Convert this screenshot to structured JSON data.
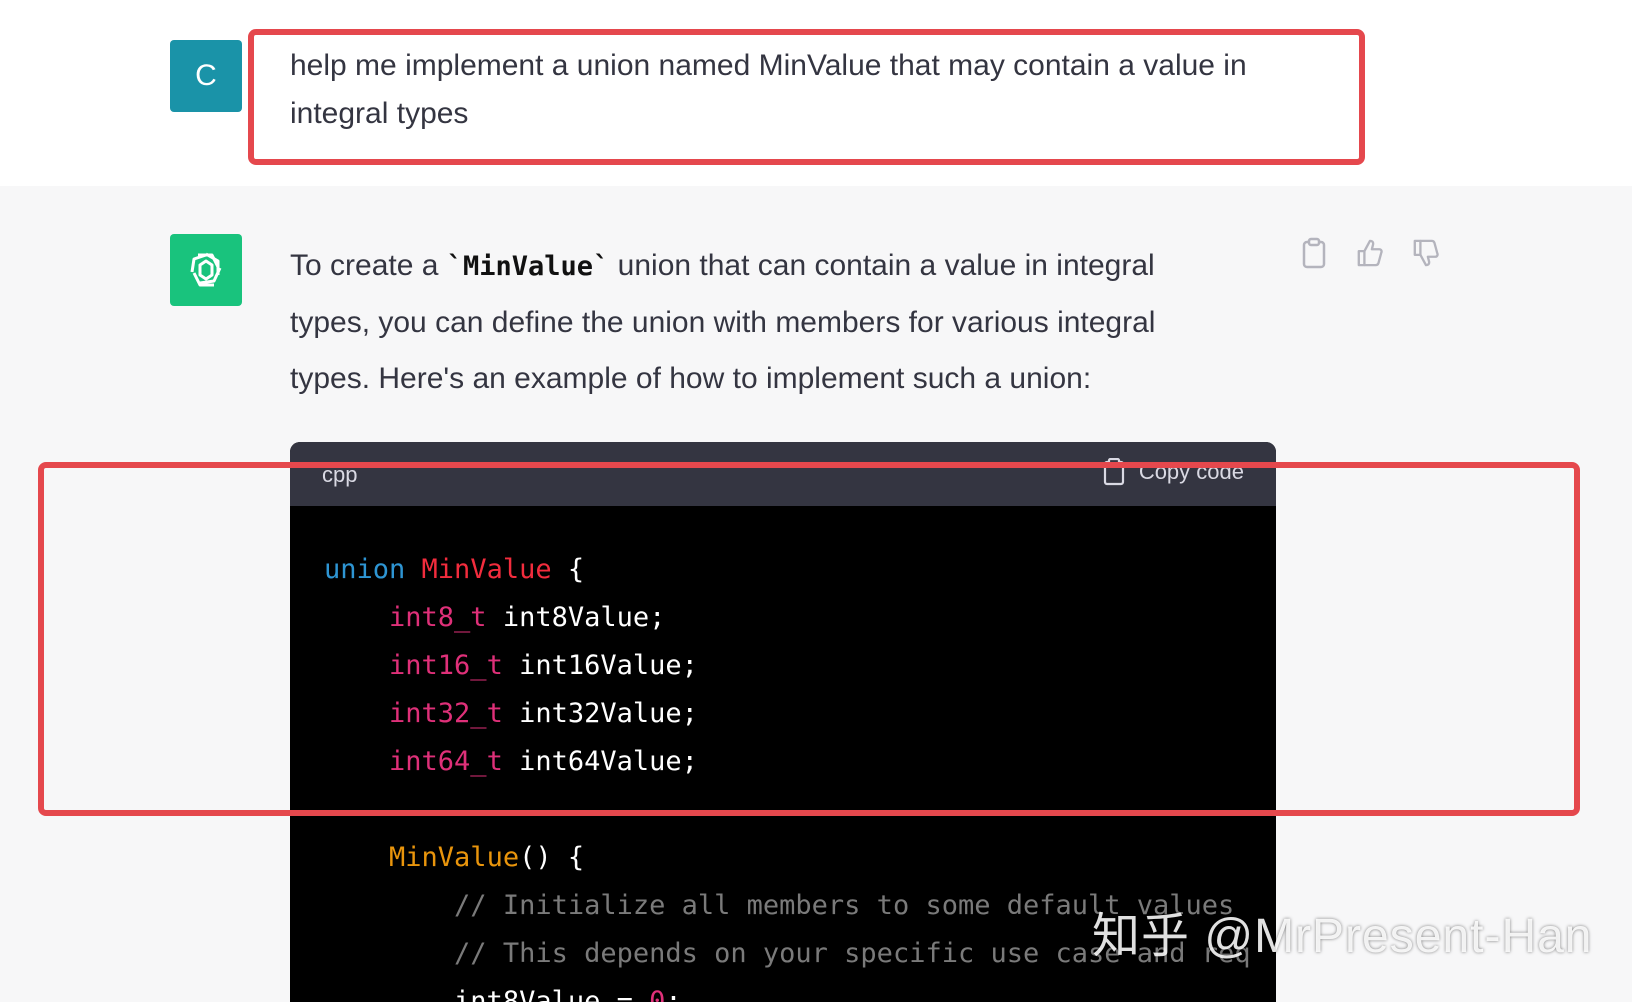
{
  "user": {
    "avatar_letter": "C",
    "message": "help me implement a union named MinValue that may contain a value in integral types"
  },
  "assistant": {
    "intro_before": "To create a ",
    "intro_code": "`MinValue`",
    "intro_after": " union that can contain a value in integral types, you can define the union with members for various integral types. Here's an example of how to implement such a union:",
    "actions": {
      "copy_icon": "clipboard-icon",
      "like_icon": "thumbs-up-icon",
      "dislike_icon": "thumbs-down-icon"
    }
  },
  "code_block": {
    "language": "cpp",
    "copy_label": "Copy code",
    "lines": {
      "l1_kw": "union",
      "l1_name": "MinValue",
      "l1_rest": " {",
      "l2_type": "int8_t",
      "l2_rest": " int8Value;",
      "l3_type": "int16_t",
      "l3_rest": " int16Value;",
      "l4_type": "int32_t",
      "l4_rest": " int32Value;",
      "l5_type": "int64_t",
      "l5_rest": " int64Value;",
      "l7_fn": "MinValue",
      "l7_rest": "() {",
      "l8_comment": "// Initialize all members to some default values",
      "l9_comment": "// This depends on your specific use case and req",
      "l10_var": "int8Value = ",
      "l10_num": "0",
      "l10_end": ";"
    }
  },
  "watermark": "知乎 @MrPresent-Han",
  "colors": {
    "user_avatar": "#1a93a8",
    "bot_avatar": "#19c37d",
    "highlight": "#e5484d"
  }
}
